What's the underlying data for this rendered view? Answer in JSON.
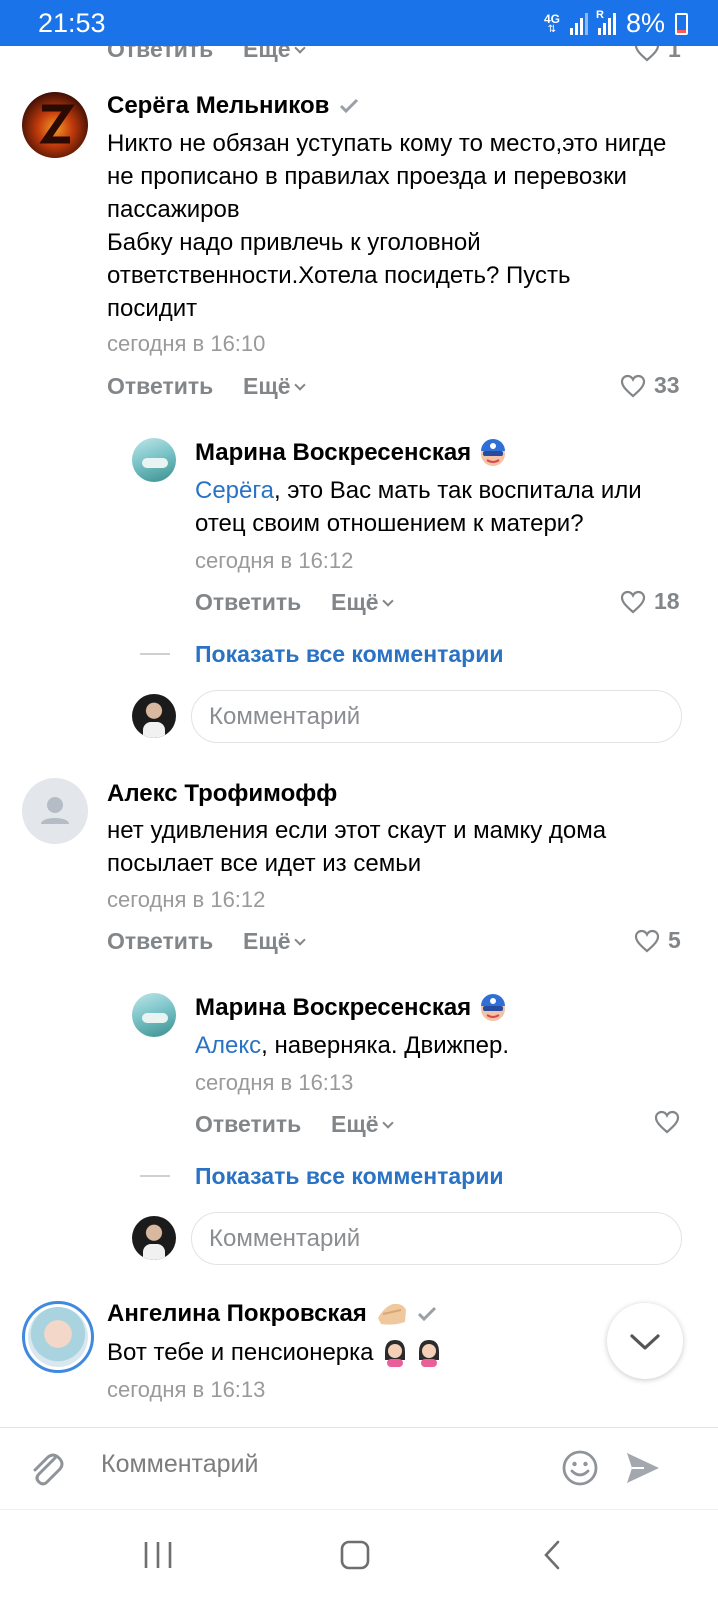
{
  "status": {
    "time": "21:53",
    "network": "4G",
    "roaming": "R",
    "battery": "8%"
  },
  "top_cut": {
    "reply_label": "Ответить",
    "more_label": "Ещё",
    "likes": "1"
  },
  "comments": [
    {
      "author": "Серёга Мельников",
      "verified": true,
      "text": "Никто не обязан уступать кому то место,это нигде не прописано в правилах проезда и перевозки пассажиров\nБабку надо привлечь к уголовной ответственности.Хотела посидеть? Пусть посидит",
      "time": "сегодня в 16:10",
      "reply_label": "Ответить",
      "more_label": "Ещё",
      "likes": "33",
      "reply": {
        "author": "Марина Воскресенская",
        "mention": "Серёга",
        "text": ", это Вас мать так воспитала или отец своим отношением к матери?",
        "time": "сегодня в 16:12",
        "reply_label": "Ответить",
        "more_label": "Ещё",
        "likes": "18"
      },
      "show_all": "Показать все комментарии",
      "input_placeholder": "Комментарий"
    },
    {
      "author": "Алекс Трофимофф",
      "text": "нет удивления если этот скаут и мамку дома посылает все идет из семьи",
      "time": "сегодня в 16:12",
      "reply_label": "Ответить",
      "more_label": "Ещё",
      "likes": "5",
      "reply": {
        "author": "Марина Воскресенская",
        "mention": "Алекс",
        "text": ", наверняка. Движпер.",
        "time": "сегодня в 16:13",
        "reply_label": "Ответить",
        "more_label": "Ещё",
        "likes": ""
      },
      "show_all": "Показать все комментарии",
      "input_placeholder": "Комментарий"
    },
    {
      "author": "Ангелина Покровская",
      "verified": true,
      "text": "Вот тебе и пенсионерка",
      "time": "сегодня в 16:13"
    }
  ],
  "composer": {
    "placeholder": "Комментарий"
  },
  "icons": {
    "attach": "paperclip-icon",
    "emoji": "smile-icon",
    "send": "send-icon",
    "scroll": "chevron-down-icon",
    "nav": [
      "recents-icon",
      "home-icon",
      "back-icon"
    ]
  },
  "colors": {
    "status_bar": "#1a73e8",
    "link": "#2a72c4",
    "muted": "#8c8c8c"
  }
}
